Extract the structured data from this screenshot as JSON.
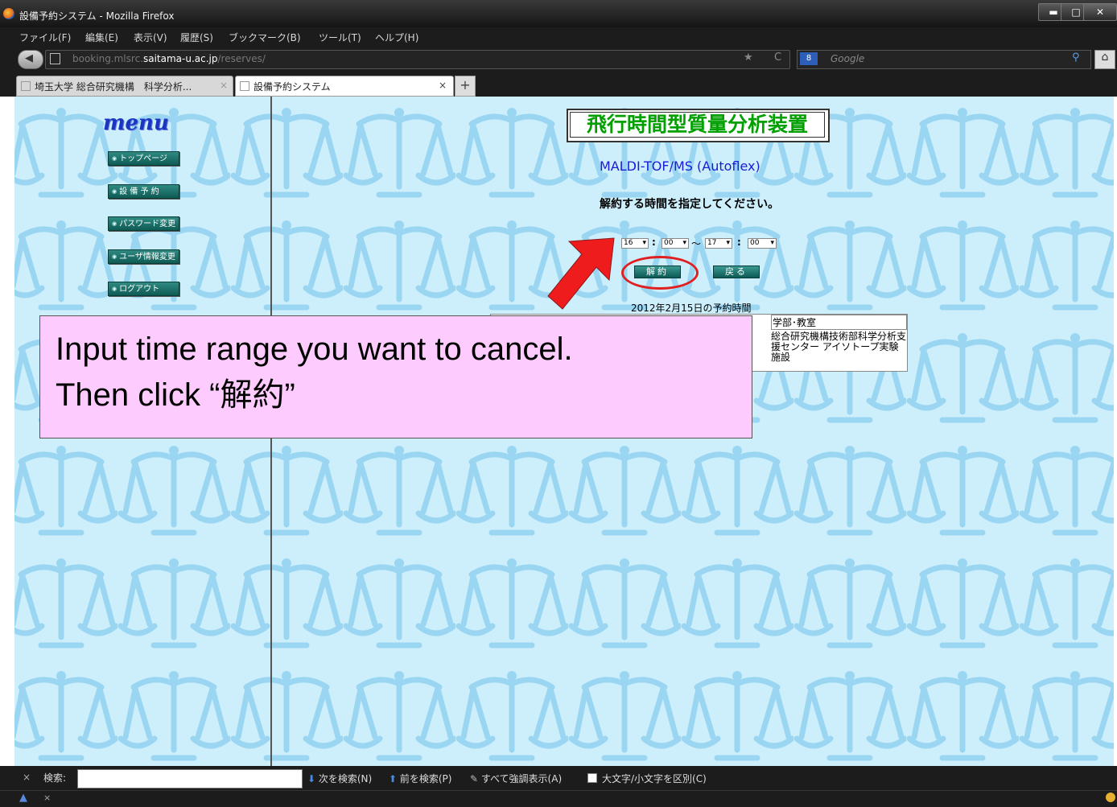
{
  "window": {
    "title": "設備予約システム - Mozilla Firefox",
    "controls": {
      "minimize": "▬",
      "maximize": "□",
      "close": "✕"
    }
  },
  "menubar": [
    "ファイル(F)",
    "編集(E)",
    "表示(V)",
    "履歴(S)",
    "ブックマーク(B)",
    "ツール(T)",
    "ヘルプ(H)"
  ],
  "navbar": {
    "url_prefix": "booking.mlsrc.",
    "url_domain": "saitama-u.ac.jp",
    "url_path": "/reserves/",
    "search_placeholder": "Google",
    "search_engine_label": "8"
  },
  "tabs": [
    {
      "label": "埼玉大学 総合研究機構　科学分析...",
      "close": "×",
      "active": false
    },
    {
      "label": "設備予約システム",
      "close": "×",
      "active": true
    }
  ],
  "new_tab_label": "+",
  "sidebar": {
    "logo": "menu",
    "items": [
      "トップページ",
      "設 備 予 約",
      "パスワード変更",
      "ユーザ情報変更",
      "ログアウト"
    ]
  },
  "main": {
    "title": "飛行時間型質量分析装置",
    "subtitle": "MALDI-TOF/MS (Autoflex)",
    "instruction": "解約する時間を指定してください。",
    "time_range": {
      "start_hour": "16",
      "start_minute": "00",
      "separator": "〜",
      "end_hour": "17",
      "end_minute": "00",
      "colon": ":"
    },
    "cancel_button": "解約",
    "back_button": "戻る",
    "date_label": "2012年2月15日の予約時間",
    "table": {
      "dept_header": "学部･教室",
      "dept_value": "総合研究機構技術部科学分析支援センター アイソトープ実験施設"
    }
  },
  "callout": {
    "line1": "Input time range you want to cancel.",
    "line2": "Then click “解約”"
  },
  "findbar": {
    "close": "×",
    "label": "検索:",
    "value": "",
    "next": "次を検索(N)",
    "prev": "前を検索(P)",
    "highlight": "すべて強調表示(A)",
    "match_case": "大文字/小文字を区別(C)"
  },
  "statusbar": {
    "close": "×"
  },
  "colors": {
    "content_bg": "#cdeffc",
    "pattern": "#9ad6f2",
    "title_text": "#00a000",
    "subtitle_text": "#1a1ad8",
    "callout_bg": "#fdcbfd",
    "arrow": "#ee1c1c",
    "sidebar_button": "#0e5b54"
  }
}
